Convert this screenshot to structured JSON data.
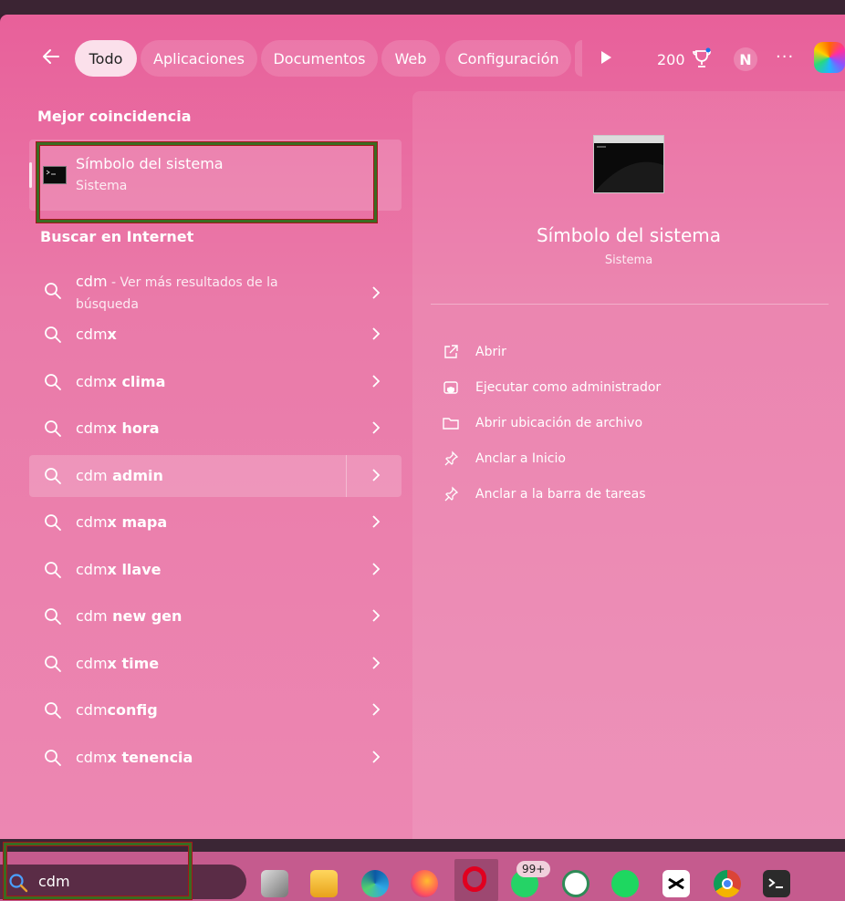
{
  "header": {
    "tabs": [
      {
        "label": "Todo",
        "active": true
      },
      {
        "label": "Aplicaciones"
      },
      {
        "label": "Documentos"
      },
      {
        "label": "Web"
      },
      {
        "label": "Configuración"
      }
    ],
    "points": "200",
    "avatar_initial": "N",
    "more_label": "···"
  },
  "best_match": {
    "section_title": "Mejor coincidencia",
    "title": "Símbolo del sistema",
    "subtitle": "Sistema"
  },
  "internet": {
    "section_title": "Buscar en Internet",
    "first": {
      "query": "cdm",
      "extra": " - Ver más resultados de la",
      "extra2": "búsqueda"
    },
    "rows": [
      {
        "prefix": "cdm",
        "suffix": "x"
      },
      {
        "prefix": "cdm",
        "suffix": "x clima"
      },
      {
        "prefix": "cdm",
        "suffix": "x hora"
      },
      {
        "prefix": "cdm",
        "suffix": " admin"
      },
      {
        "prefix": "cdm",
        "suffix": "x mapa"
      },
      {
        "prefix": "cdm",
        "suffix": "x llave"
      },
      {
        "prefix": "cdm",
        "suffix": " new gen"
      },
      {
        "prefix": "cdm",
        "suffix": "x time"
      },
      {
        "prefix": "cdm",
        "suffix": "config"
      },
      {
        "prefix": "cdm",
        "suffix": "x tenencia"
      }
    ]
  },
  "preview": {
    "title": "Símbolo del sistema",
    "subtitle": "Sistema",
    "actions": [
      {
        "label": "Abrir",
        "icon": "open-external-icon"
      },
      {
        "label": "Ejecutar como administrador",
        "icon": "admin-shield-icon"
      },
      {
        "label": "Abrir ubicación de archivo",
        "icon": "folder-icon"
      },
      {
        "label": "Anclar a Inicio",
        "icon": "pin-icon"
      },
      {
        "label": "Anclar a la barra de tareas",
        "icon": "pin-icon"
      }
    ]
  },
  "taskbar": {
    "search_value": "cdm",
    "whatsapp_badge": "99+"
  },
  "colors": {
    "panel_top": "#e8609a",
    "panel_bottom": "#ec87b2",
    "taskbar": "#c55b8e",
    "highlight_box": "#3a6b22"
  }
}
